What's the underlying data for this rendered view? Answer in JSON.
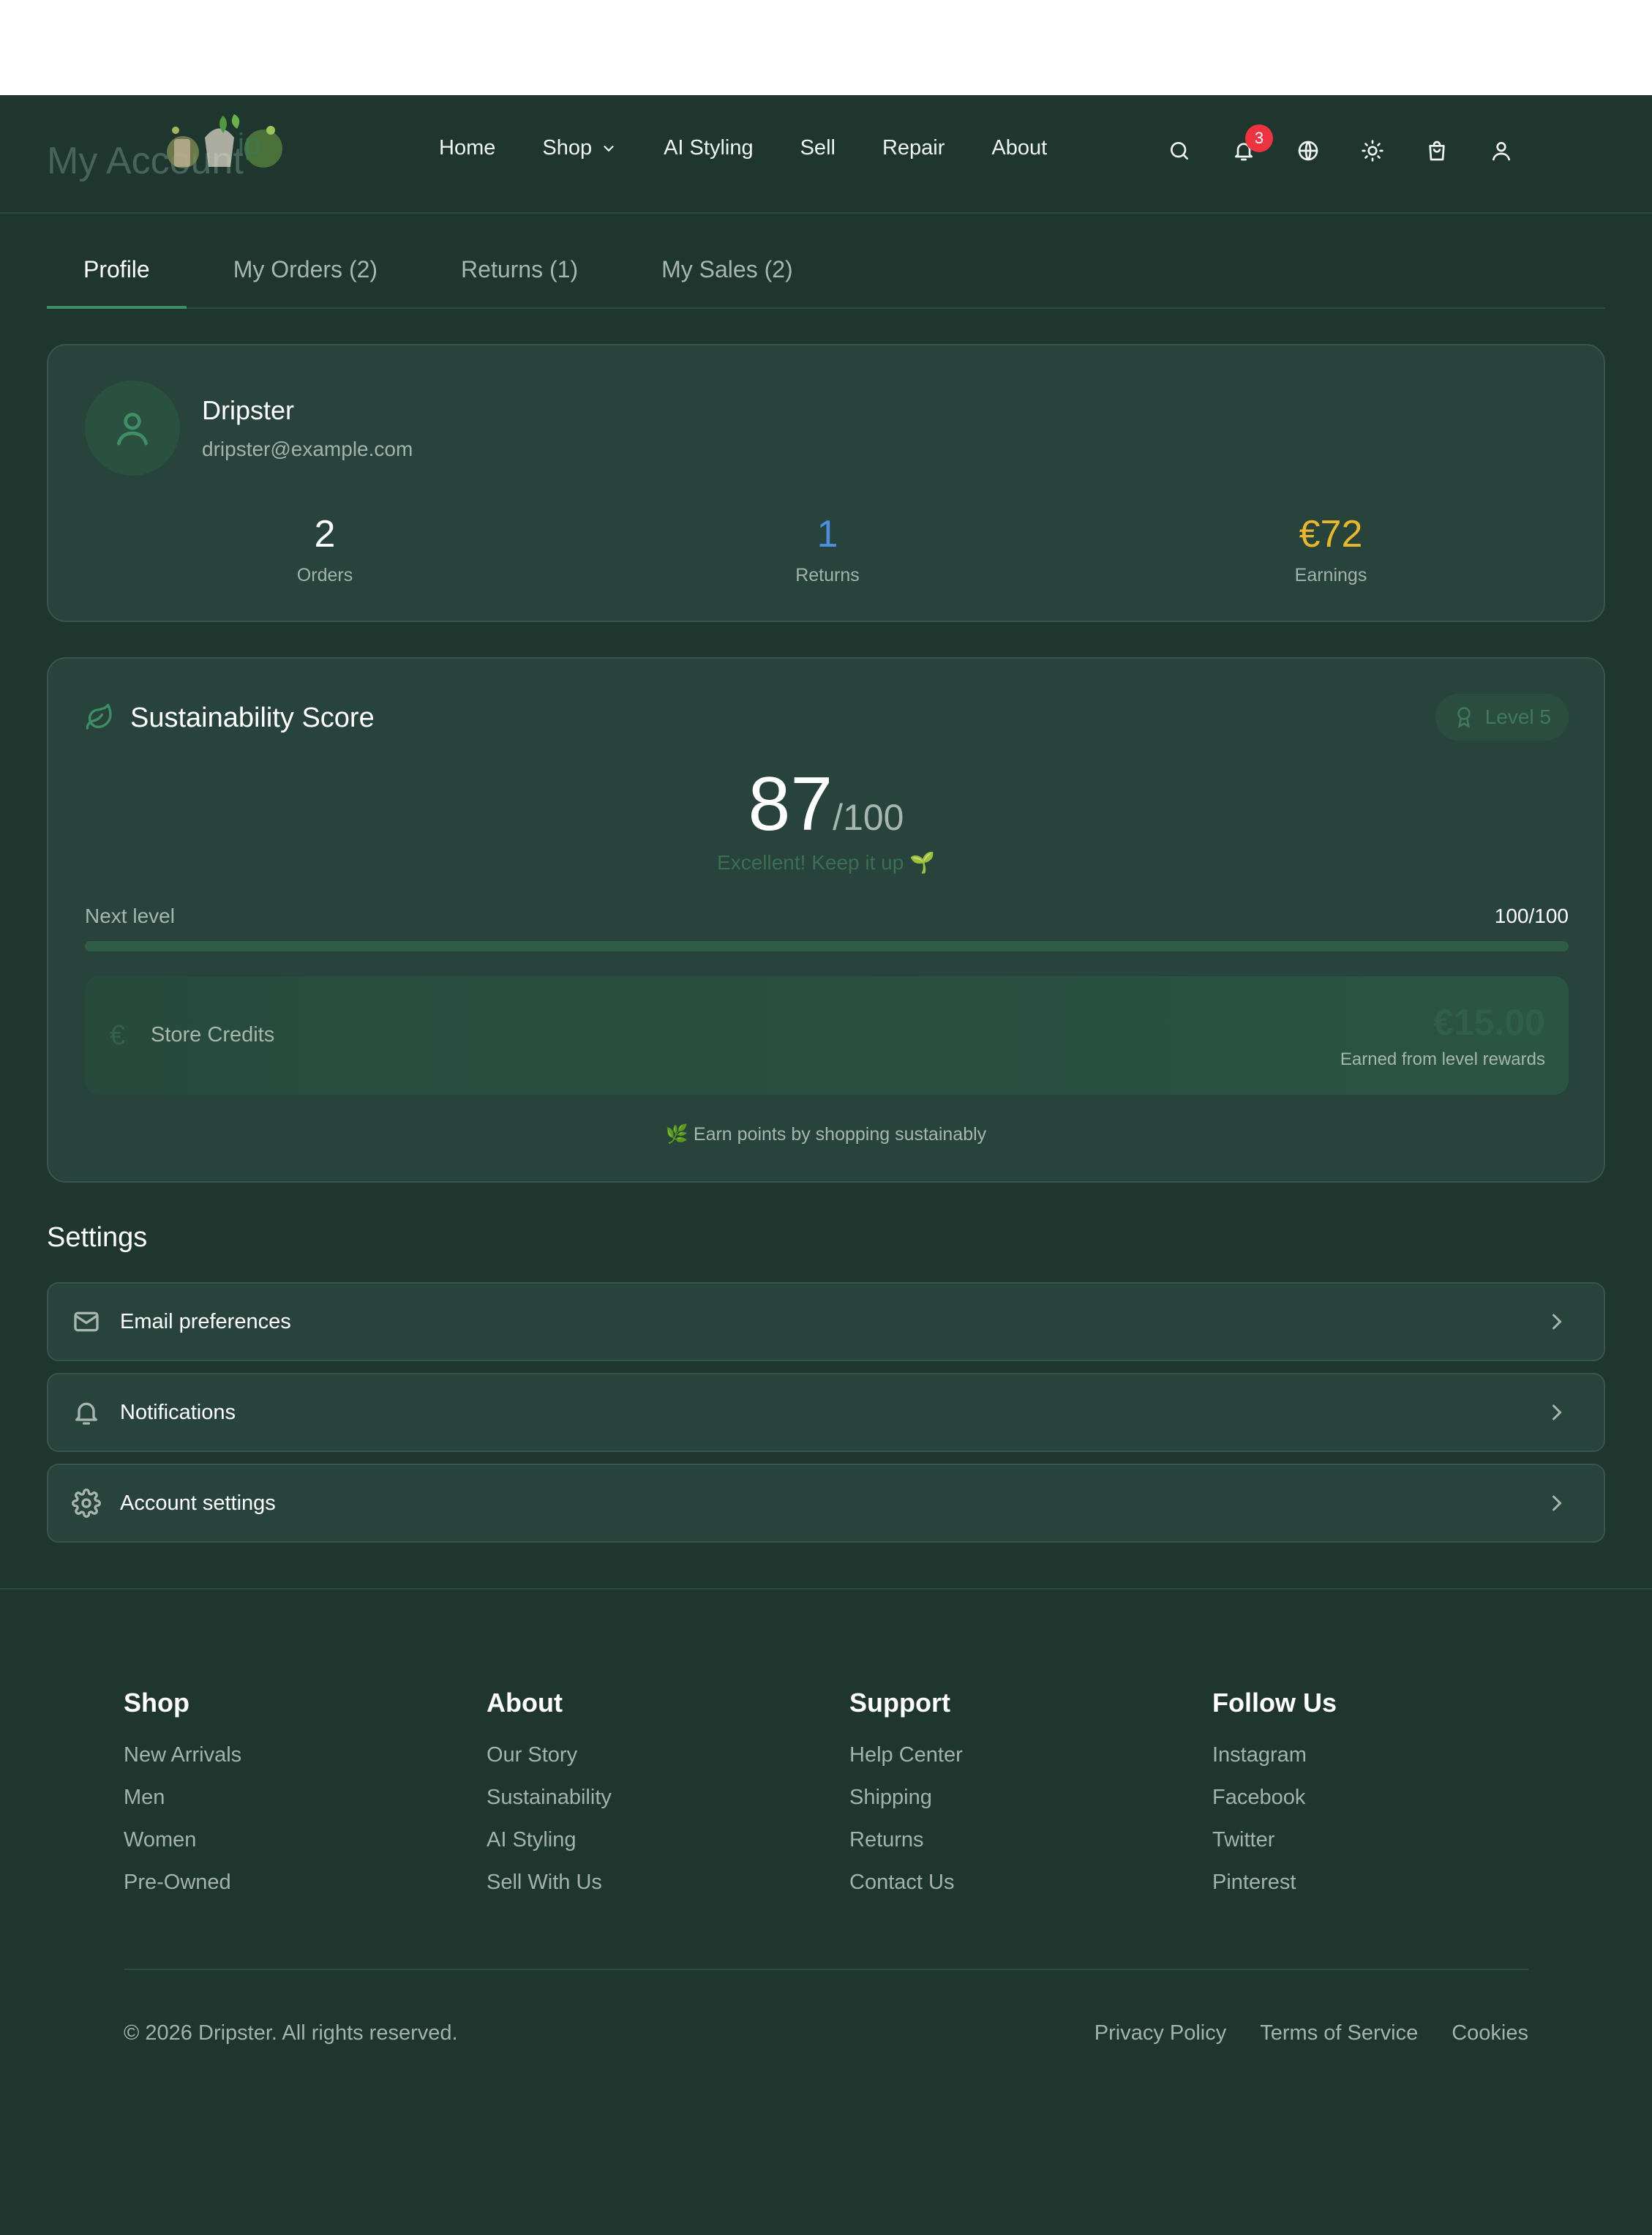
{
  "page": {
    "title": "My Account"
  },
  "nav": {
    "items": [
      {
        "label": "Home"
      },
      {
        "label": "Shop"
      },
      {
        "label": "AI Styling"
      },
      {
        "label": "Sell"
      },
      {
        "label": "Repair"
      },
      {
        "label": "About"
      }
    ]
  },
  "header": {
    "icons": [
      "search-icon",
      "bell-icon",
      "globe-icon",
      "sun-icon",
      "shopping-bag-icon",
      "user-icon"
    ],
    "notification_count": "3"
  },
  "tabs": [
    {
      "label": "Profile",
      "active": true
    },
    {
      "label": "My Orders (2)"
    },
    {
      "label": "Returns (1)"
    },
    {
      "label": "My Sales (2)"
    }
  ],
  "profile": {
    "name": "Dripster",
    "email": "dripster@example.com",
    "stats": [
      {
        "value": "2",
        "label": "Orders",
        "color": "#ffffff"
      },
      {
        "value": "1",
        "label": "Returns",
        "color": "#4d8fe0"
      },
      {
        "value": "€72",
        "label": "Earnings",
        "color": "#e8b82a"
      }
    ]
  },
  "sustainability": {
    "title": "Sustainability Score",
    "level": "Level 5",
    "score": "87",
    "out_of": "/100",
    "message": "Excellent! Keep it up 🌱",
    "next_level_label": "Next level",
    "next_level_value": "100/100",
    "progress_fraction": 1.0,
    "store_credits": {
      "label": "Store Credits",
      "currency_icon": "€",
      "amount": "€15.00",
      "note": "Earned from level rewards"
    },
    "footer_note": "🌿 Earn points by shopping sustainably"
  },
  "settings": {
    "title": "Settings",
    "items": [
      {
        "label": "Email preferences",
        "icon": "mail-icon"
      },
      {
        "label": "Notifications",
        "icon": "bell-icon"
      },
      {
        "label": "Account settings",
        "icon": "gear-icon"
      }
    ]
  },
  "footer": {
    "columns": [
      {
        "heading": "Shop",
        "links": [
          "New Arrivals",
          "Men",
          "Women",
          "Pre-Owned"
        ]
      },
      {
        "heading": "About",
        "links": [
          "Our Story",
          "Sustainability",
          "AI Styling",
          "Sell With Us"
        ]
      },
      {
        "heading": "Support",
        "links": [
          "Help Center",
          "Shipping",
          "Returns",
          "Contact Us"
        ]
      },
      {
        "heading": "Follow Us",
        "links": [
          "Instagram",
          "Facebook",
          "Twitter",
          "Pinterest"
        ]
      }
    ],
    "copyright": "© 2026 Dripster. All rights reserved.",
    "legal": [
      "Privacy Policy",
      "Terms of Service",
      "Cookies"
    ]
  },
  "colors": {
    "background": "#1f362f",
    "card": "#28433b",
    "accent": "#3f8f66",
    "badge": "#ee3340"
  }
}
